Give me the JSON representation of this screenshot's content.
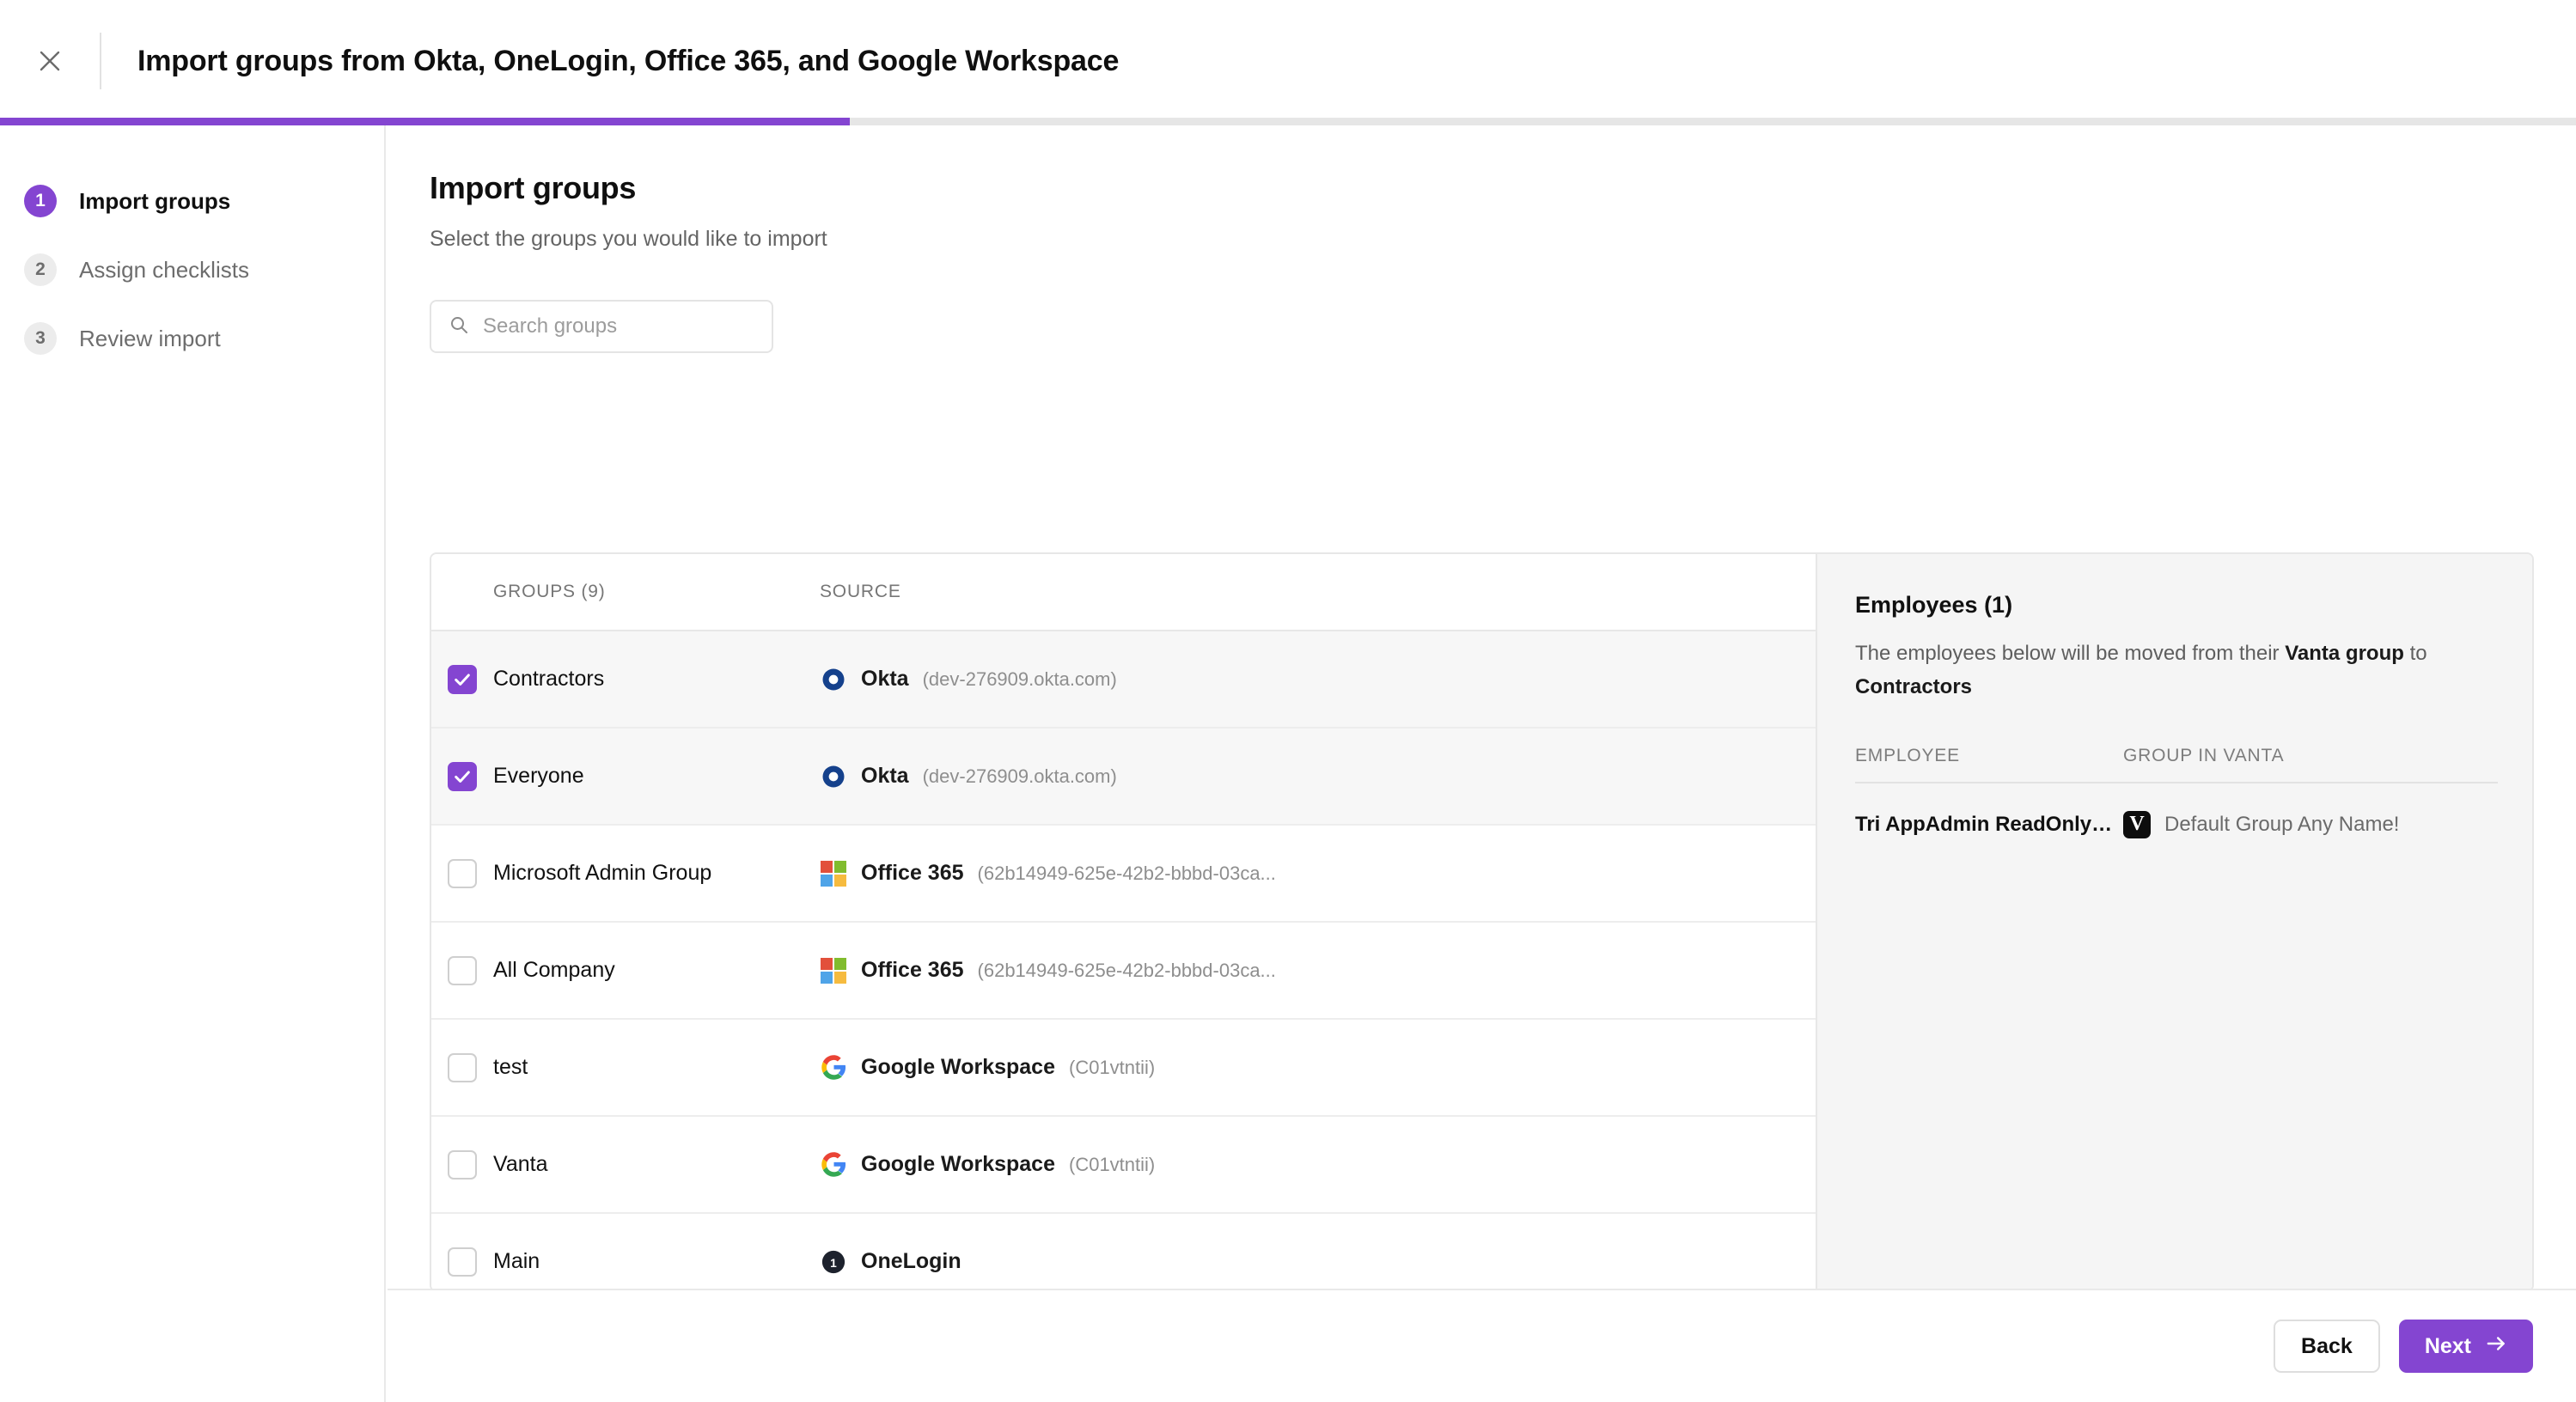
{
  "header": {
    "close_icon": "close-icon",
    "title": "Import groups from Okta, OneLogin, Office 365, and Google Workspace"
  },
  "progress": {
    "percent": 33,
    "accent_color": "#8445d1"
  },
  "steps": [
    {
      "number": "1",
      "label": "Import groups",
      "state": "active"
    },
    {
      "number": "2",
      "label": "Assign checklists",
      "state": "idle"
    },
    {
      "number": "3",
      "label": "Review import",
      "state": "idle"
    }
  ],
  "main": {
    "title": "Import groups",
    "subtitle": "Select the groups you would like to import"
  },
  "search": {
    "placeholder": "Search groups",
    "value": "",
    "icon": "search-icon"
  },
  "table": {
    "columns": {
      "groups": "GROUPS (9)",
      "source": "SOURCE"
    },
    "rows": [
      {
        "name": "Contractors",
        "checked": true,
        "source": "Okta",
        "source_id": "(dev-276909.okta.com)",
        "logo": "okta-icon"
      },
      {
        "name": "Everyone",
        "checked": true,
        "source": "Okta",
        "source_id": "(dev-276909.okta.com)",
        "logo": "okta-icon"
      },
      {
        "name": "Microsoft Admin Group",
        "checked": false,
        "source": "Office 365",
        "source_id": "(62b14949-625e-42b2-bbbd-03ca...",
        "logo": "microsoft-icon"
      },
      {
        "name": "All Company",
        "checked": false,
        "source": "Office 365",
        "source_id": "(62b14949-625e-42b2-bbbd-03ca...",
        "logo": "microsoft-icon"
      },
      {
        "name": "test",
        "checked": false,
        "source": "Google Workspace",
        "source_id": "(C01vtntii)",
        "logo": "google-icon"
      },
      {
        "name": "Vanta",
        "checked": false,
        "source": "Google Workspace",
        "source_id": "(C01vtntii)",
        "logo": "google-icon"
      },
      {
        "name": "Main",
        "checked": false,
        "source": "OneLogin",
        "source_id": "",
        "logo": "onelogin-icon"
      }
    ]
  },
  "detail": {
    "title": "Employees (1)",
    "desc_1": "The employees below will be moved from their ",
    "desc_bold_1": "Vanta group",
    "desc_2": " to ",
    "desc_bold_2": "Contractors",
    "columns": {
      "employee": "EMPLOYEE",
      "group_in_vanta": "GROUP IN VANTA"
    },
    "rows": [
      {
        "employee": "Tri AppAdmin ReadOnlyAd...",
        "badge": "V",
        "group": "Default Group Any Name!"
      }
    ]
  },
  "footer": {
    "back_label": "Back",
    "next_label": "Next",
    "next_icon": "arrow-right-icon"
  }
}
